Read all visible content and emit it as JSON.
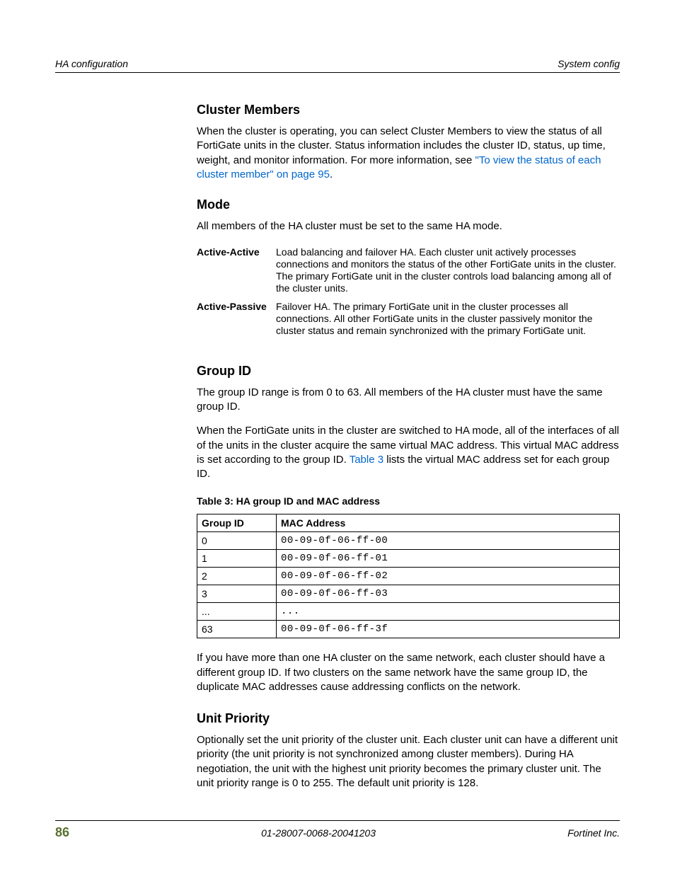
{
  "running_head": {
    "left": "HA configuration",
    "right": "System config"
  },
  "cluster_members": {
    "heading": "Cluster Members",
    "p1a": "When the cluster is operating, you can select Cluster Members to view the status of all FortiGate units in the cluster. Status information includes the cluster ID, status, up time, weight, and monitor information. For more information, see ",
    "link": "\"To view the status of each cluster member\" on page 95",
    "p1b": "."
  },
  "mode": {
    "heading": "Mode",
    "intro": "All members of the HA cluster must be set to the same HA mode.",
    "rows": [
      {
        "term": "Active-Active",
        "desc": "Load balancing and failover HA. Each cluster unit actively processes connections and monitors the status of the other FortiGate units in the cluster. The primary FortiGate unit in the cluster controls load balancing among all of the cluster units."
      },
      {
        "term": "Active-Passive",
        "desc": "Failover HA. The primary FortiGate unit in the cluster processes all connections. All other FortiGate units in the cluster passively monitor the cluster status and remain synchronized with the primary FortiGate unit."
      }
    ]
  },
  "group_id": {
    "heading": "Group ID",
    "p1": "The group ID range is from 0 to 63. All members of the HA cluster must have the same group ID.",
    "p2a": "When the FortiGate units in the cluster are switched to HA mode, all of the interfaces of all of the units in the cluster acquire the same virtual MAC address. This virtual MAC address is set according to the group ID. ",
    "p2link": "Table 3",
    "p2b": " lists the virtual MAC address set for each group ID.",
    "table_caption": "Table 3: HA group ID and MAC address",
    "headers": {
      "c1": "Group ID",
      "c2": "MAC Address"
    },
    "rows": [
      {
        "gid": "0",
        "mac": "00-09-0f-06-ff-00"
      },
      {
        "gid": "1",
        "mac": "00-09-0f-06-ff-01"
      },
      {
        "gid": "2",
        "mac": "00-09-0f-06-ff-02"
      },
      {
        "gid": "3",
        "mac": "00-09-0f-06-ff-03"
      },
      {
        "gid": "...",
        "mac": "..."
      },
      {
        "gid": "63",
        "mac": "00-09-0f-06-ff-3f"
      }
    ],
    "p3": "If you have more than one HA cluster on the same network, each cluster should have a different group ID. If two clusters on the same network have the same group ID, the duplicate MAC addresses cause addressing conflicts on the network."
  },
  "unit_priority": {
    "heading": "Unit Priority",
    "p1": "Optionally set the unit priority of the cluster unit. Each cluster unit can have a different unit priority (the unit priority is not synchronized among cluster members). During HA negotiation, the unit with the highest unit priority becomes the primary cluster unit. The unit priority range is 0 to 255. The default unit priority is 128."
  },
  "footer": {
    "page_number": "86",
    "doc_id": "01-28007-0068-20041203",
    "brand": "Fortinet Inc."
  }
}
